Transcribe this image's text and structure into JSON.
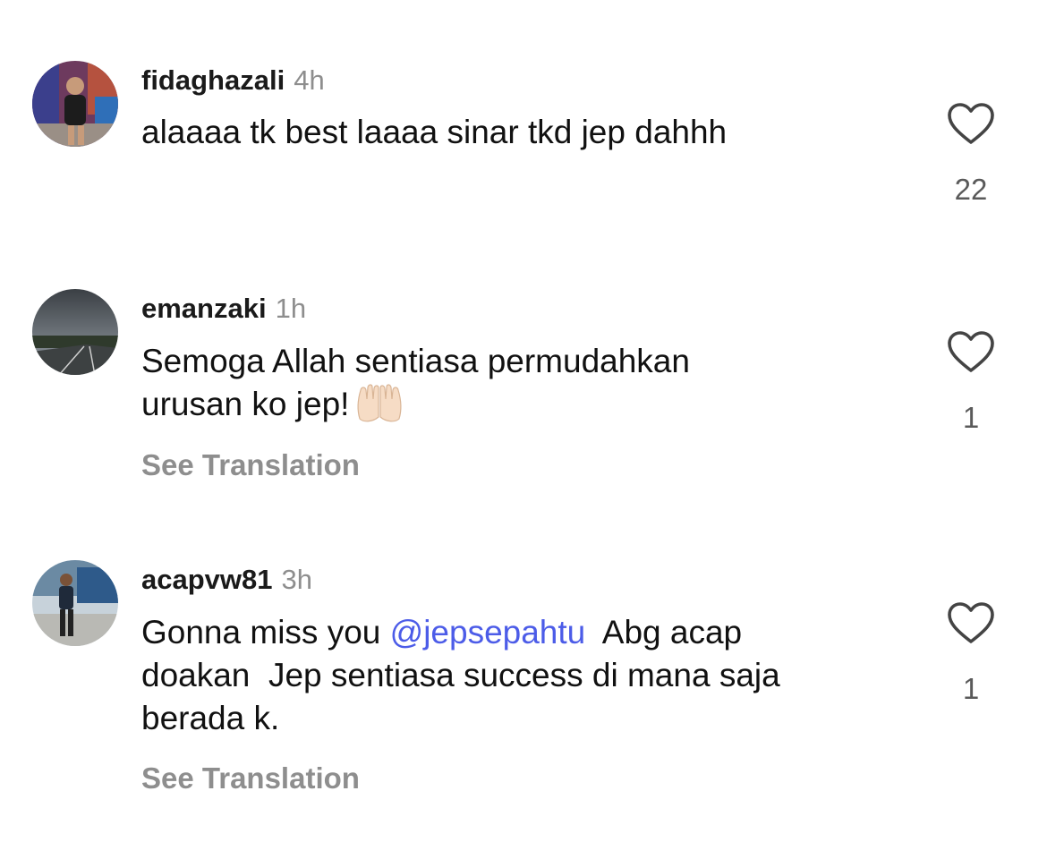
{
  "comments": [
    {
      "username": "fidaghazali",
      "time": "4h",
      "text": "alaaaa tk best laaaa sinar tkd jep dahhh",
      "likes": "22"
    },
    {
      "username": "emanzaki",
      "time": "1h",
      "text_line1": "Semoga Allah sentiasa permudahkan",
      "text_line2": "urusan ko jep!",
      "emoji": "🙌🏻",
      "see_translation": "See Translation",
      "likes": "1"
    },
    {
      "username": "acapvw81",
      "time": "3h",
      "text_before": "Gonna miss you ",
      "mention": "@jepsepahtu",
      "text_after_line1": "  Abg acap",
      "text_line2": "doakan  Jep sentiasa success di mana saja",
      "text_line3": "berada k.",
      "see_translation": "See Translation",
      "likes": "1"
    }
  ],
  "icons": {
    "like": "heart-outline-icon",
    "emoji": "raising-hands-emoji"
  },
  "colors": {
    "mention": "#4c5ce8",
    "secondary_text": "#8e8e8e"
  }
}
